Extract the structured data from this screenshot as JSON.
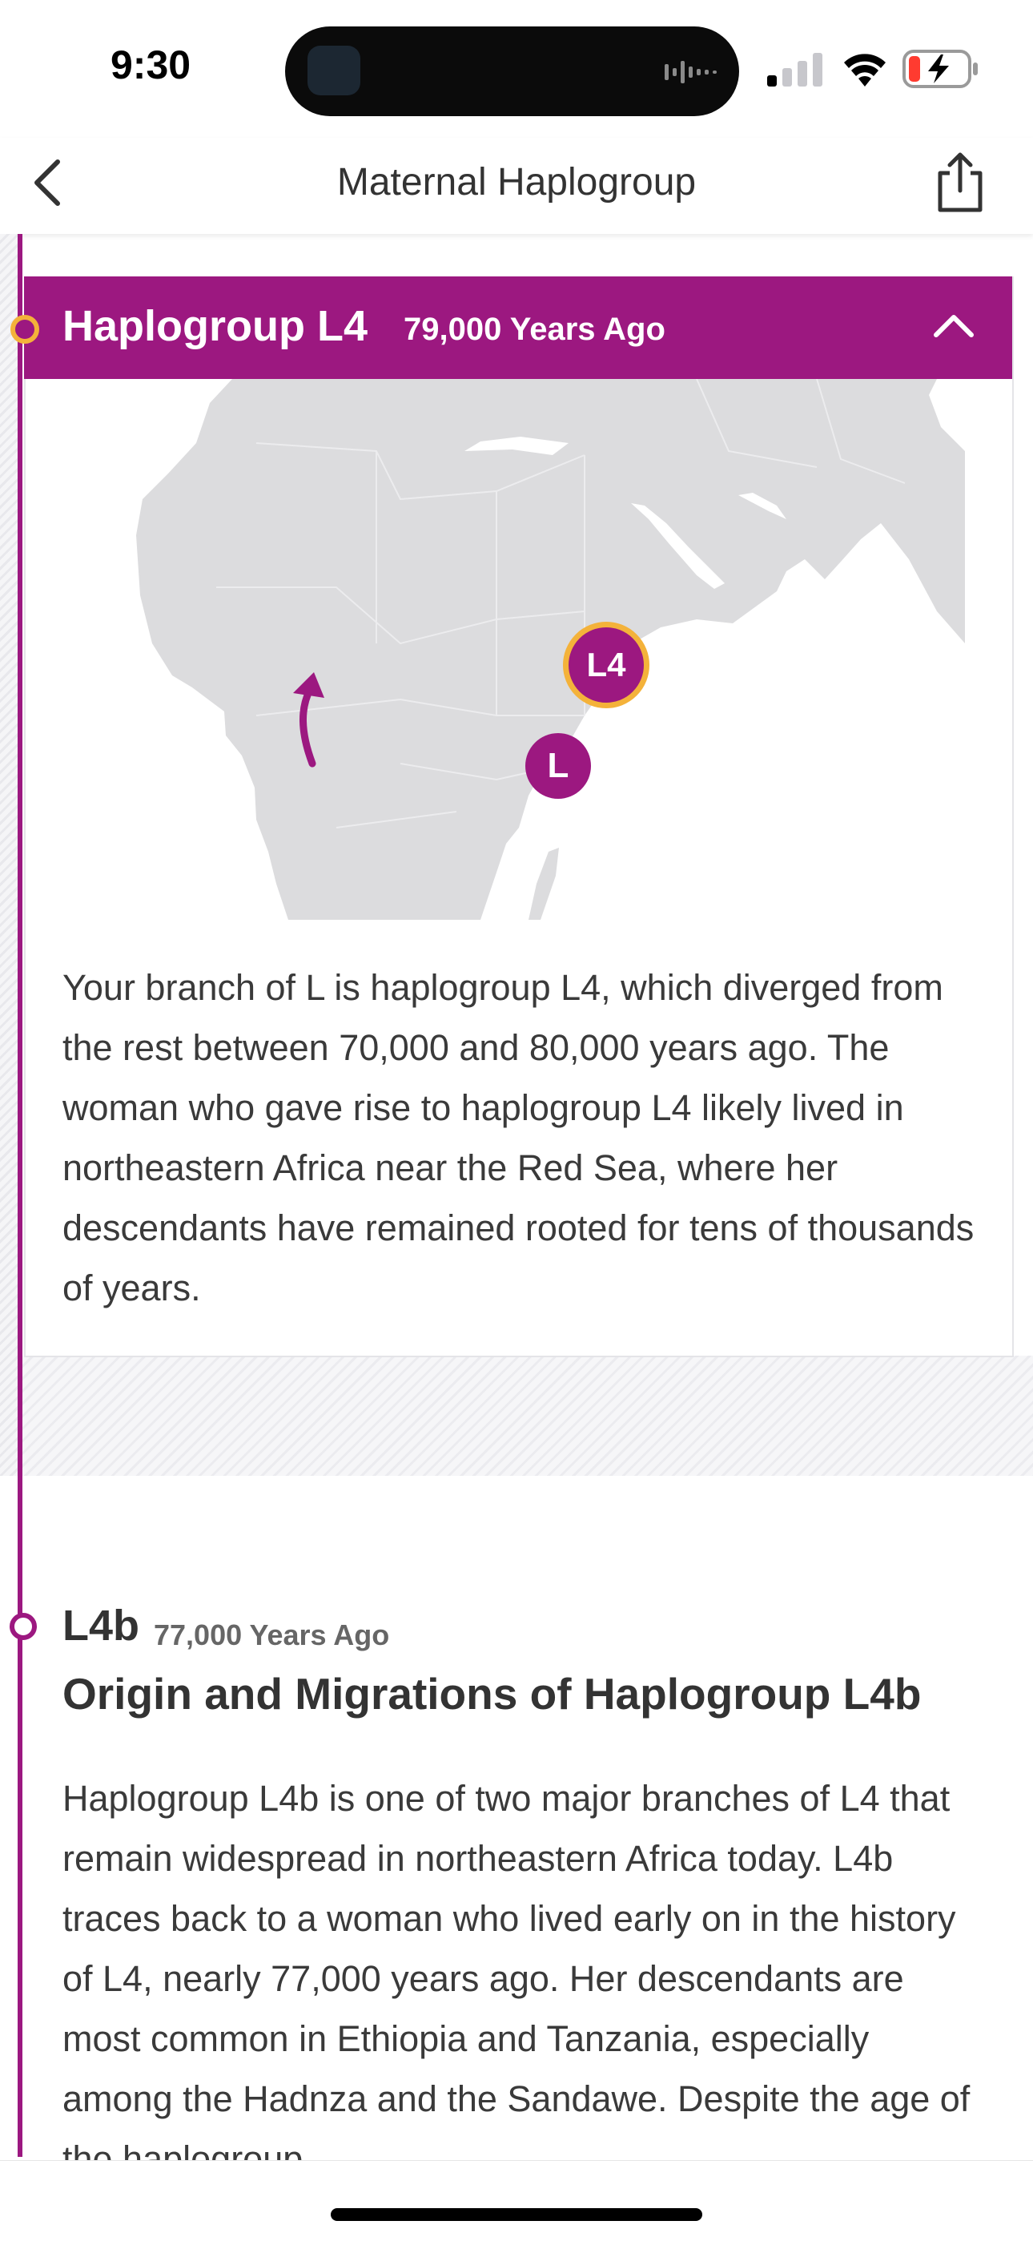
{
  "status_bar": {
    "time": "9:30"
  },
  "nav": {
    "title": "Maternal Haplogroup"
  },
  "section_l4": {
    "title": "Haplogroup L4",
    "years": "79,000 Years Ago",
    "map": {
      "origin_label": "L",
      "destination_label": "L4"
    },
    "paragraph": "Your branch of L is haplogroup L4, which diverged from the rest between 70,000 and 80,000 years ago. The woman who gave rise to haplogroup L4 likely lived in northeastern Africa near the Red Sea, where her descendants have remained rooted for tens of thousands of years."
  },
  "section_l4b": {
    "name": "L4b",
    "years": "77,000 Years Ago",
    "heading": "Origin and Migrations of Haplogroup L4b",
    "paragraph": "Haplogroup L4b is one of two major branches of L4 that remain widespread in northeastern Africa today. L4b traces back to a woman who lived early on in the history of L4, nearly 77,000 years ago. Her descendants are most common in Ethiopia and Tanzania, especially among the Hadnza and the Sandawe. Despite the age of the haplogroup,"
  },
  "colors": {
    "accent": "#9c1880",
    "highlight": "#f4b23a",
    "map_land": "#dcdcde"
  }
}
